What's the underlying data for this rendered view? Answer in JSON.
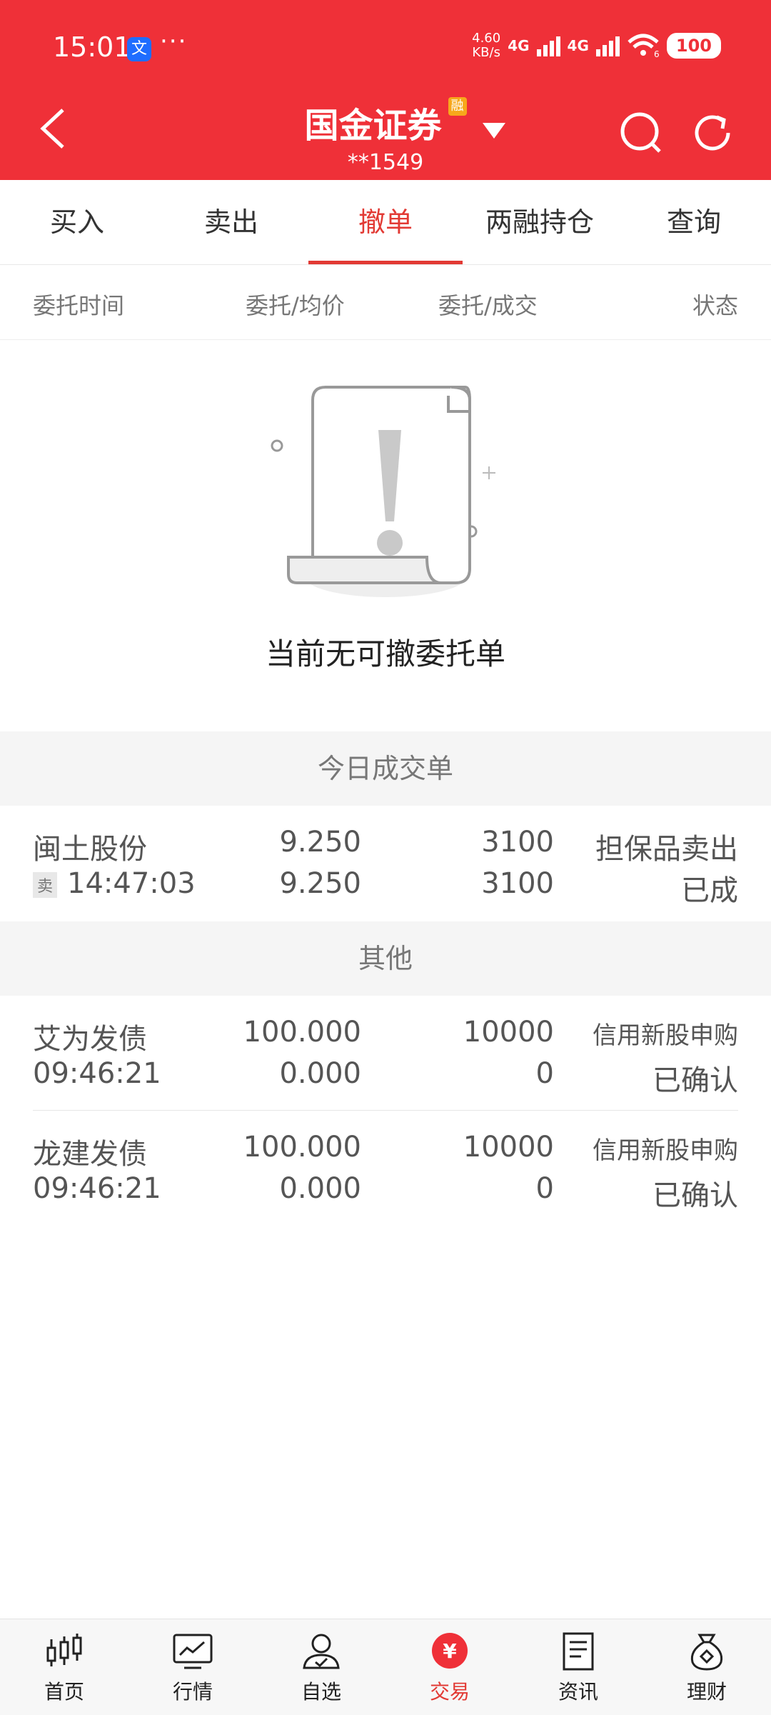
{
  "status_bar": {
    "time": "15:01",
    "app_glyph": "文",
    "dots": "···",
    "speed_value": "4.60",
    "speed_unit": "KB/s",
    "net1": "4G",
    "net2": "4G",
    "wifi_sub": "6",
    "battery": "100"
  },
  "header": {
    "broker": "国金证券",
    "badge": "融",
    "account": "**1549"
  },
  "tabs": [
    {
      "label": "买入"
    },
    {
      "label": "卖出"
    },
    {
      "label": "撤单",
      "active": true
    },
    {
      "label": "两融持仓"
    },
    {
      "label": "查询"
    }
  ],
  "columns": [
    "委托时间",
    "委托/均价",
    "委托/成交",
    "状态"
  ],
  "empty": {
    "message": "当前无可撤委托单"
  },
  "sections": {
    "today": "今日成交单",
    "other": "其他"
  },
  "today_rows": [
    {
      "name": "闽土股份",
      "tag": "卖",
      "time": "14:47:03",
      "price1": "9.250",
      "price2": "9.250",
      "qty1": "3100",
      "qty2": "3100",
      "type": "担保品卖出",
      "status": "已成"
    }
  ],
  "other_rows": [
    {
      "name": "艾为发债",
      "time": "09:46:21",
      "price1": "100.000",
      "price2": "0.000",
      "qty1": "10000",
      "qty2": "0",
      "type": "信用新股申购",
      "status": "已确认"
    },
    {
      "name": "龙建发债",
      "time": "09:46:21",
      "price1": "100.000",
      "price2": "0.000",
      "qty1": "10000",
      "qty2": "0",
      "type": "信用新股申购",
      "status": "已确认"
    }
  ],
  "bottom_nav": [
    {
      "label": "首页",
      "icon": "candlestick-icon"
    },
    {
      "label": "行情",
      "icon": "chart-icon"
    },
    {
      "label": "自选",
      "icon": "user-check-icon"
    },
    {
      "label": "交易",
      "icon": "yuan-icon",
      "active": true
    },
    {
      "label": "资讯",
      "icon": "document-icon"
    },
    {
      "label": "理财",
      "icon": "money-bag-icon"
    }
  ],
  "colors": {
    "brand_red": "#ef3038",
    "active_tab": "#e23a34",
    "badge_orange": "#f7a81b"
  }
}
